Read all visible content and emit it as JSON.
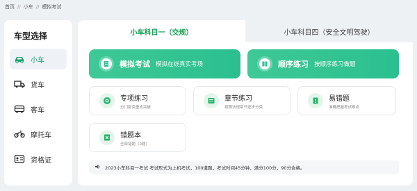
{
  "breadcrumb": {
    "items": [
      "首页",
      "小车",
      "模拟考试"
    ],
    "sep": "//"
  },
  "sidebar": {
    "title": "车型选择",
    "items": [
      {
        "label": "小车",
        "icon": "car-icon",
        "active": true
      },
      {
        "label": "货车",
        "icon": "truck-icon",
        "active": false
      },
      {
        "label": "客车",
        "icon": "bus-icon",
        "active": false
      },
      {
        "label": "摩托车",
        "icon": "motorcycle-icon",
        "active": false
      },
      {
        "label": "资格证",
        "icon": "certificate-icon",
        "active": false
      }
    ]
  },
  "tabs": [
    {
      "label": "小车科目一（交规）",
      "active": true
    },
    {
      "label": "小车科目四（安全文明驾驶）",
      "active": false
    }
  ],
  "primary": [
    {
      "title": "模拟考试",
      "subtitle": "模拟在线真实考场",
      "icon": "exam-paper-icon"
    },
    {
      "title": "顺序练习",
      "subtitle": "按顺序练习做题",
      "icon": "sequence-icon"
    }
  ],
  "cards": [
    {
      "title": "专项练习",
      "subtitle": "分门别类重点突破",
      "icon": "target-icon",
      "color": "#25b36a"
    },
    {
      "title": "章节练习",
      "subtitle": "按照法规章节逐步分类",
      "icon": "chapter-icon",
      "color": "#25b36a"
    },
    {
      "title": "易错题",
      "subtitle": "准确把握考试难点",
      "icon": "warning-icon",
      "color": "#25b36a"
    },
    {
      "title": "错题本",
      "subtitle": "全部错题（0题）",
      "icon": "wrong-book-icon",
      "color": "#25b36a"
    }
  ],
  "notice": "2023小车科目一考试 考试形式为上机考试，100道题，考试时间45分钟，满分100分，90分合格。",
  "colors": {
    "accent": "#1a9f55",
    "gradient_start": "#3ec996",
    "gradient_end": "#2bbf8f",
    "bg": "#eef1f4"
  }
}
